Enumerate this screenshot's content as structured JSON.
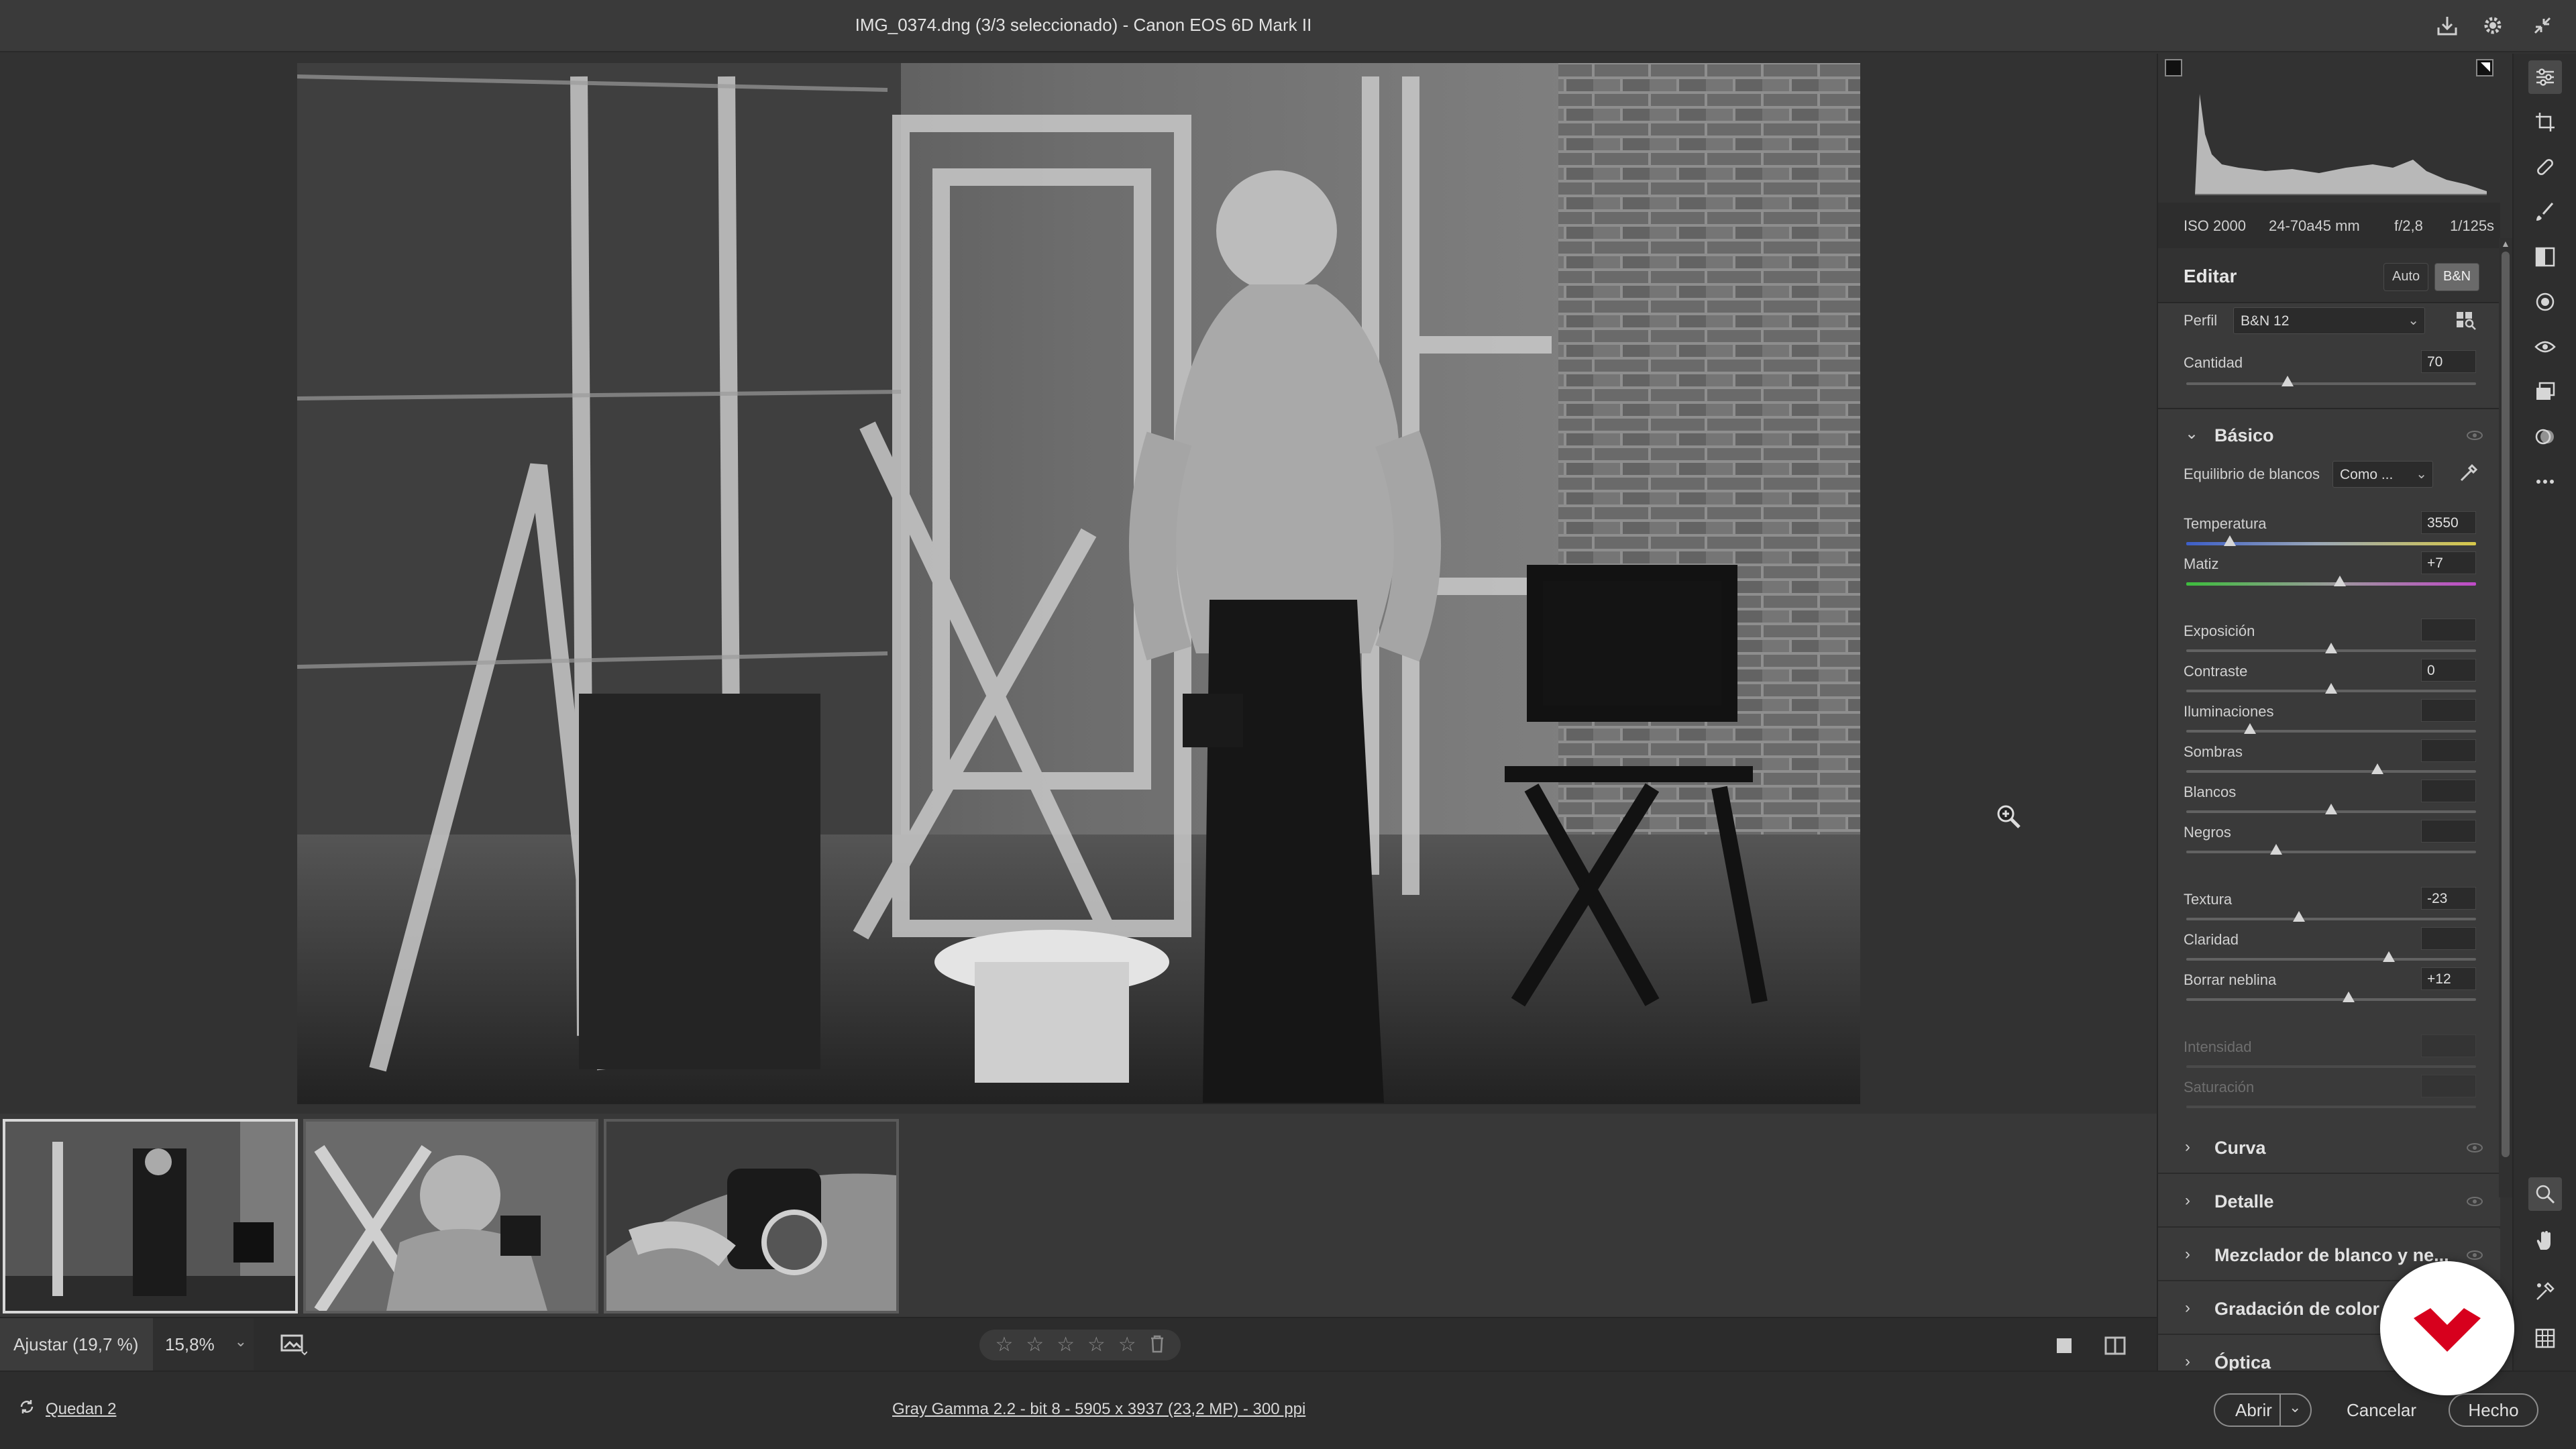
{
  "titlebar": {
    "title": "IMG_0374.dng (3/3 seleccionado) -  Canon EOS 6D Mark II",
    "icons": [
      "save-icon",
      "gear-icon",
      "collapse-icon"
    ]
  },
  "canvas": {
    "cursor": "zoom-in-icon"
  },
  "filmstrip": {
    "thumbnails": [
      {
        "selected": true
      },
      {
        "selected": false
      },
      {
        "selected": false
      }
    ]
  },
  "viewbar": {
    "fit_label": "Ajustar (19,7 %)",
    "zoom_value": "15,8%",
    "rating_stars": 5,
    "rating_value": 0
  },
  "statusbar": {
    "remaining": "Quedan 2",
    "workflow_options": "Gray Gamma 2.2 - bit 8 - 5905 x 3937 (23,2 MP) - 300 ppi",
    "open_label": "Abrir",
    "cancel_label": "Cancelar",
    "done_label": "Hecho"
  },
  "panel": {
    "camera_info": {
      "iso": "ISO 2000",
      "lens": "24-70a45 mm",
      "aperture": "f/2,8",
      "shutter": "1/125s"
    },
    "edit_title": "Editar",
    "auto_label": "Auto",
    "bw_label": "B&N",
    "profile_label": "Perfil",
    "profile_value": "B&N 12",
    "amount_label": "Cantidad",
    "amount_value": "70",
    "amount_level": 0.35,
    "basic": {
      "title": "Básico",
      "wb_label": "Equilibrio de blancos",
      "wb_value": "Como ...",
      "sliders": [
        {
          "label": "Temperatura",
          "value": "3550",
          "level": 0.15,
          "kind": "temp"
        },
        {
          "label": "Matiz",
          "value": "+7",
          "level": 0.53,
          "kind": "tint"
        },
        {
          "label": "Exposición",
          "value": "",
          "level": 0.5
        },
        {
          "label": "Contraste",
          "value": "0",
          "level": 0.5
        },
        {
          "label": "Iluminaciones",
          "value": "",
          "level": 0.22
        },
        {
          "label": "Sombras",
          "value": "",
          "level": 0.66
        },
        {
          "label": "Blancos",
          "value": "",
          "level": 0.5
        },
        {
          "label": "Negros",
          "value": "",
          "level": 0.31
        },
        {
          "label": "Textura",
          "value": "-23",
          "level": 0.39
        },
        {
          "label": "Claridad",
          "value": "",
          "level": 0.7
        },
        {
          "label": "Borrar neblina",
          "value": "+12",
          "level": 0.56
        },
        {
          "label": "Intensidad",
          "value": "",
          "level": null,
          "dim": true
        },
        {
          "label": "Saturación",
          "value": "",
          "level": null,
          "dim": true
        }
      ]
    },
    "sections": [
      {
        "title": "Curva"
      },
      {
        "title": "Detalle"
      },
      {
        "title": "Mezclador de blanco y ne..."
      },
      {
        "title": "Gradación de color"
      },
      {
        "title": "Óptica"
      }
    ]
  },
  "toolstrip": {
    "tools": [
      "edit-sliders-icon",
      "crop-icon",
      "healing-icon",
      "brush-icon",
      "gradient-icon",
      "radial-filter-icon",
      "red-eye-icon",
      "presets-icon",
      "snapshots-icon",
      "more-icon"
    ],
    "bottom_tools": [
      "zoom-icon",
      "hand-icon",
      "color-sampler-icon",
      "grid-icon"
    ]
  },
  "colors": {
    "background": "#323232",
    "panel": "#3a3a3a",
    "brand": "#d7001d"
  }
}
